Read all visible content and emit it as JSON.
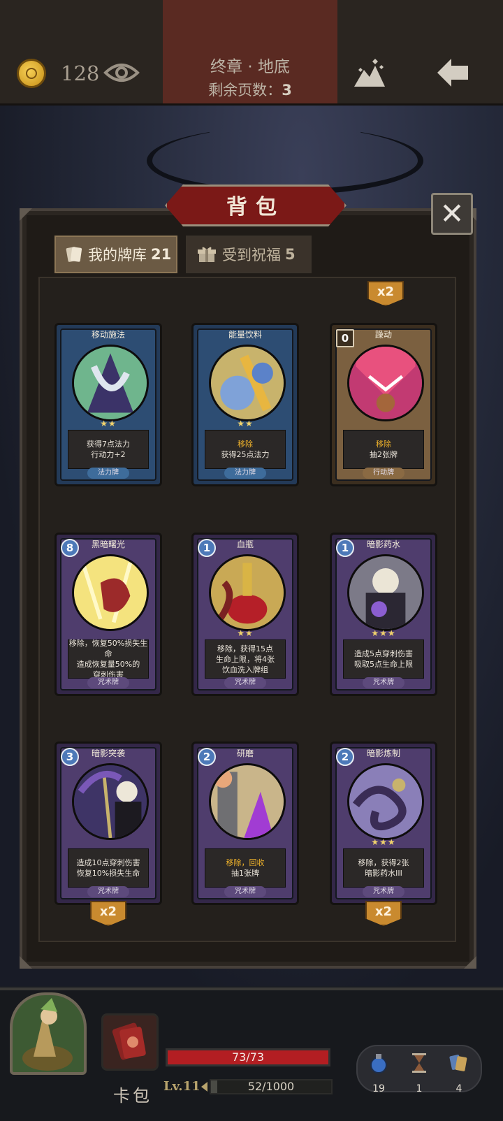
{
  "header": {
    "coins": "128",
    "chapter": "终章 · 地底",
    "pages_left_label": "剩余页数：",
    "pages_left_value": "3"
  },
  "bag": {
    "title": "背包",
    "close_symbol": "✕",
    "tabs": [
      {
        "label": "我的牌库",
        "count": "21",
        "icon": "cards-icon",
        "active": true
      },
      {
        "label": "受到祝福",
        "count": "5",
        "icon": "gift-icon",
        "active": false
      }
    ],
    "top_badge": "x2",
    "cards": [
      {
        "name": "移动施法",
        "cost": "",
        "stars": "★★",
        "lines": [
          {
            "text": "获得7点法力",
            "hl": false
          },
          {
            "text": "行动力+2",
            "hl": false
          }
        ],
        "type": "法力牌",
        "color": "blue",
        "badge": ""
      },
      {
        "name": "能量饮料",
        "cost": "",
        "stars": "★★",
        "lines": [
          {
            "text": "移除",
            "hl": true
          },
          {
            "text": "获得25点法力",
            "hl": false
          }
        ],
        "type": "法力牌",
        "color": "blue",
        "badge": ""
      },
      {
        "name": "躁动",
        "cost": "0",
        "stars": "",
        "lines": [
          {
            "text": "移除",
            "hl": true
          },
          {
            "text": "抽2张牌",
            "hl": false
          }
        ],
        "type": "行动牌",
        "color": "tan",
        "badge": ""
      },
      {
        "name": "黑暗曙光",
        "cost": "8",
        "stars": "",
        "lines": [
          {
            "text": "移除，恢复50%损失生命",
            "hl": false
          },
          {
            "text": "造成恢复量50%的",
            "hl": false
          },
          {
            "text": "穿刺伤害",
            "hl": false
          }
        ],
        "type": "咒术牌",
        "color": "purple",
        "badge": ""
      },
      {
        "name": "血瓶",
        "cost": "1",
        "stars": "★★",
        "lines": [
          {
            "text": "移除，获得15点",
            "hl": false
          },
          {
            "text": "生命上限，将4张",
            "hl": false
          },
          {
            "text": "饮血洗入牌组",
            "hl": false
          }
        ],
        "type": "咒术牌",
        "color": "purple",
        "badge": ""
      },
      {
        "name": "暗影药水",
        "cost": "1",
        "stars": "★★★",
        "lines": [
          {
            "text": "造成5点穿刺伤害",
            "hl": false
          },
          {
            "text": "吸取5点生命上限",
            "hl": false
          }
        ],
        "type": "咒术牌",
        "color": "purple",
        "badge": ""
      },
      {
        "name": "暗影突袭",
        "cost": "3",
        "stars": "",
        "lines": [
          {
            "text": "造成10点穿刺伤害",
            "hl": false
          },
          {
            "text": "恢复10%损失生命",
            "hl": false
          }
        ],
        "type": "咒术牌",
        "color": "purple",
        "badge": "x2"
      },
      {
        "name": "研磨",
        "cost": "2",
        "stars": "",
        "lines": [
          {
            "text": "移除，回收",
            "hl": true
          },
          {
            "text": "抽1张牌",
            "hl": false
          }
        ],
        "type": "咒术牌",
        "color": "purple",
        "badge": ""
      },
      {
        "name": "暗影炼制",
        "cost": "2",
        "stars": "★★★",
        "lines": [
          {
            "text": "移除，获得2张",
            "hl": false
          },
          {
            "text": "暗影药水III",
            "hl": false
          }
        ],
        "type": "咒术牌",
        "color": "purple",
        "badge": "x2"
      }
    ]
  },
  "footer": {
    "deck_label": "卡包",
    "hp_text": "73/73",
    "hp_fraction": 1.0,
    "level": "Lv.11",
    "xp_text": "52/1000",
    "xp_fraction": 0.052,
    "resources": [
      {
        "icon": "potion-icon",
        "value": "19"
      },
      {
        "icon": "hourglass-icon",
        "value": "1"
      },
      {
        "icon": "cards-icon",
        "value": "4"
      }
    ]
  }
}
